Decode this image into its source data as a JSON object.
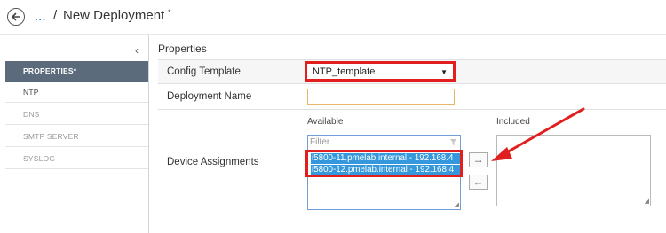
{
  "header": {
    "breadcrumb_ellipsis": "...",
    "separator": "/",
    "title": "New Deployment",
    "unsaved_marker": "*"
  },
  "sidebar": {
    "collapse_glyph": "‹",
    "items": [
      {
        "label": "PROPERTIES*",
        "active": true
      },
      {
        "label": "NTP",
        "active": false
      },
      {
        "label": "DNS",
        "active": false
      },
      {
        "label": "SMTP SERVER",
        "active": false
      },
      {
        "label": "SYSLOG",
        "active": false
      }
    ]
  },
  "main": {
    "section_title": "Properties",
    "config_template": {
      "label": "Config Template",
      "value": "NTP_template"
    },
    "deployment_name": {
      "label": "Deployment Name",
      "value": ""
    },
    "device_assignments": {
      "label": "Device Assignments",
      "available_heading": "Available",
      "included_heading": "Included",
      "filter_placeholder": "Filter",
      "available_items": [
        "i5800-11.pmelab.internal - 192.168.4",
        "i5800-12.pmelab.internal - 192.168.4"
      ],
      "add_button": "→",
      "remove_button": "←"
    }
  },
  "colors": {
    "accent_blue": "#3598dc",
    "sidebar_active": "#5b6b7c",
    "annotation_red": "#e21f1f",
    "link_blue": "#2a7ab8"
  }
}
